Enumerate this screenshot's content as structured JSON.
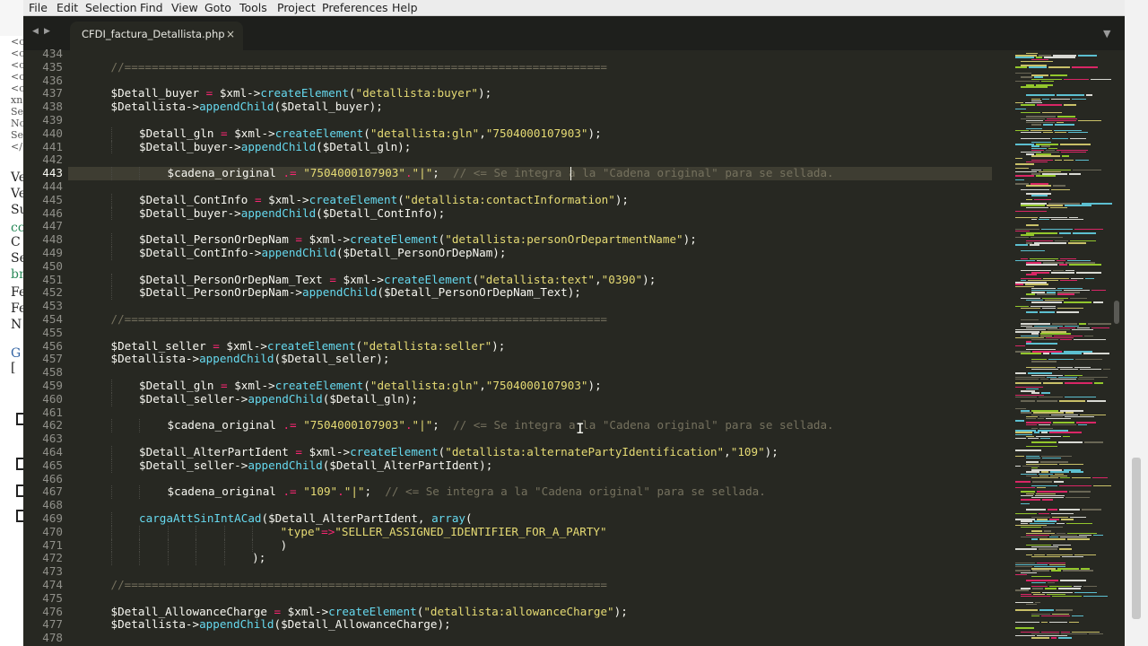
{
  "menu": [
    "File",
    "Edit",
    "Selection",
    "Find",
    "View",
    "Goto",
    "Tools",
    "Project",
    "Preferences",
    "Help"
  ],
  "tab": {
    "name": "CFDI_factura_Detallista.php",
    "close": "×"
  },
  "nav": {
    "back": "◀",
    "forward": "▶",
    "dropdown": "▼"
  },
  "background_page": {
    "left_fragments": [
      "<c",
      "<c",
      "<c",
      "<c",
      "<c",
      "xn",
      "Se",
      "No",
      "Se",
      "</",
      "Ve",
      "Ve",
      "Su",
      "cc",
      "C",
      "Se",
      "br",
      "Fe",
      "Fe",
      "N",
      "G",
      "["
    ]
  },
  "editor": {
    "current_line": 443,
    "lines": [
      {
        "n": 434,
        "indent": 0,
        "tokens": []
      },
      {
        "n": 435,
        "indent": 4,
        "tokens": [
          {
            "t": "//=======================================================================",
            "c": "cm"
          }
        ]
      },
      {
        "n": 436,
        "indent": 0,
        "tokens": []
      },
      {
        "n": 437,
        "indent": 4,
        "tokens": [
          {
            "t": "$Detall_buyer",
            "c": "v"
          },
          {
            "t": " = ",
            "c": "op"
          },
          {
            "t": "$xml->",
            "c": "v"
          },
          {
            "t": "createElement",
            "c": "fn"
          },
          {
            "t": "(",
            "c": "p"
          },
          {
            "t": "\"detallista:buyer\"",
            "c": "str"
          },
          {
            "t": ");",
            "c": "p"
          }
        ]
      },
      {
        "n": 438,
        "indent": 4,
        "tokens": [
          {
            "t": "$Detallista->",
            "c": "v"
          },
          {
            "t": "appendChild",
            "c": "fn"
          },
          {
            "t": "($Detall_buyer);",
            "c": "p"
          }
        ]
      },
      {
        "n": 439,
        "indent": 0,
        "tokens": []
      },
      {
        "n": 440,
        "indent": 8,
        "tokens": [
          {
            "t": "$Detall_gln",
            "c": "v"
          },
          {
            "t": " = ",
            "c": "op"
          },
          {
            "t": "$xml->",
            "c": "v"
          },
          {
            "t": "createElement",
            "c": "fn"
          },
          {
            "t": "(",
            "c": "p"
          },
          {
            "t": "\"detallista:gln\"",
            "c": "str"
          },
          {
            "t": ",",
            "c": "p"
          },
          {
            "t": "\"7504000107903\"",
            "c": "str"
          },
          {
            "t": ");",
            "c": "p"
          }
        ]
      },
      {
        "n": 441,
        "indent": 8,
        "tokens": [
          {
            "t": "$Detall_buyer->",
            "c": "v"
          },
          {
            "t": "appendChild",
            "c": "fn"
          },
          {
            "t": "($Detall_gln);",
            "c": "p"
          }
        ]
      },
      {
        "n": 442,
        "indent": 0,
        "tokens": []
      },
      {
        "n": 443,
        "indent": 12,
        "tokens": [
          {
            "t": "$cadena_original",
            "c": "v"
          },
          {
            "t": " .= ",
            "c": "op"
          },
          {
            "t": "\"7504000107903\"",
            "c": "str"
          },
          {
            "t": ".",
            "c": "op"
          },
          {
            "t": "\"|\"",
            "c": "str"
          },
          {
            "t": ";  ",
            "c": "p"
          },
          {
            "t": "// <= Se integra a la \"Cadena original\" para se sellada.",
            "c": "cm"
          }
        ]
      },
      {
        "n": 444,
        "indent": 0,
        "tokens": []
      },
      {
        "n": 445,
        "indent": 8,
        "tokens": [
          {
            "t": "$Detall_ContInfo",
            "c": "v"
          },
          {
            "t": " = ",
            "c": "op"
          },
          {
            "t": "$xml->",
            "c": "v"
          },
          {
            "t": "createElement",
            "c": "fn"
          },
          {
            "t": "(",
            "c": "p"
          },
          {
            "t": "\"detallista:contactInformation\"",
            "c": "str"
          },
          {
            "t": ");",
            "c": "p"
          }
        ]
      },
      {
        "n": 446,
        "indent": 8,
        "tokens": [
          {
            "t": "$Detall_buyer->",
            "c": "v"
          },
          {
            "t": "appendChild",
            "c": "fn"
          },
          {
            "t": "($Detall_ContInfo);",
            "c": "p"
          }
        ]
      },
      {
        "n": 447,
        "indent": 0,
        "tokens": []
      },
      {
        "n": 448,
        "indent": 8,
        "tokens": [
          {
            "t": "$Detall_PersonOrDepNam",
            "c": "v"
          },
          {
            "t": " = ",
            "c": "op"
          },
          {
            "t": "$xml->",
            "c": "v"
          },
          {
            "t": "createElement",
            "c": "fn"
          },
          {
            "t": "(",
            "c": "p"
          },
          {
            "t": "\"detallista:personOrDepartmentName\"",
            "c": "str"
          },
          {
            "t": ");",
            "c": "p"
          }
        ]
      },
      {
        "n": 449,
        "indent": 8,
        "tokens": [
          {
            "t": "$Detall_ContInfo->",
            "c": "v"
          },
          {
            "t": "appendChild",
            "c": "fn"
          },
          {
            "t": "($Detall_PersonOrDepNam);",
            "c": "p"
          }
        ]
      },
      {
        "n": 450,
        "indent": 0,
        "tokens": []
      },
      {
        "n": 451,
        "indent": 8,
        "tokens": [
          {
            "t": "$Detall_PersonOrDepNam_Text",
            "c": "v"
          },
          {
            "t": " = ",
            "c": "op"
          },
          {
            "t": "$xml->",
            "c": "v"
          },
          {
            "t": "createElement",
            "c": "fn"
          },
          {
            "t": "(",
            "c": "p"
          },
          {
            "t": "\"detallista:text\"",
            "c": "str"
          },
          {
            "t": ",",
            "c": "p"
          },
          {
            "t": "\"0390\"",
            "c": "str"
          },
          {
            "t": ");",
            "c": "p"
          }
        ]
      },
      {
        "n": 452,
        "indent": 8,
        "tokens": [
          {
            "t": "$Detall_PersonOrDepNam->",
            "c": "v"
          },
          {
            "t": "appendChild",
            "c": "fn"
          },
          {
            "t": "($Detall_PersonOrDepNam_Text);",
            "c": "p"
          }
        ]
      },
      {
        "n": 453,
        "indent": 0,
        "tokens": []
      },
      {
        "n": 454,
        "indent": 4,
        "tokens": [
          {
            "t": "//=======================================================================",
            "c": "cm"
          }
        ]
      },
      {
        "n": 455,
        "indent": 0,
        "tokens": []
      },
      {
        "n": 456,
        "indent": 4,
        "tokens": [
          {
            "t": "$Detall_seller",
            "c": "v"
          },
          {
            "t": " = ",
            "c": "op"
          },
          {
            "t": "$xml->",
            "c": "v"
          },
          {
            "t": "createElement",
            "c": "fn"
          },
          {
            "t": "(",
            "c": "p"
          },
          {
            "t": "\"detallista:seller\"",
            "c": "str"
          },
          {
            "t": ");",
            "c": "p"
          }
        ]
      },
      {
        "n": 457,
        "indent": 4,
        "tokens": [
          {
            "t": "$Detallista->",
            "c": "v"
          },
          {
            "t": "appendChild",
            "c": "fn"
          },
          {
            "t": "($Detall_seller);",
            "c": "p"
          }
        ]
      },
      {
        "n": 458,
        "indent": 0,
        "tokens": []
      },
      {
        "n": 459,
        "indent": 8,
        "tokens": [
          {
            "t": "$Detall_gln",
            "c": "v"
          },
          {
            "t": " = ",
            "c": "op"
          },
          {
            "t": "$xml->",
            "c": "v"
          },
          {
            "t": "createElement",
            "c": "fn"
          },
          {
            "t": "(",
            "c": "p"
          },
          {
            "t": "\"detallista:gln\"",
            "c": "str"
          },
          {
            "t": ",",
            "c": "p"
          },
          {
            "t": "\"7504000107903\"",
            "c": "str"
          },
          {
            "t": ");",
            "c": "p"
          }
        ]
      },
      {
        "n": 460,
        "indent": 8,
        "tokens": [
          {
            "t": "$Detall_seller->",
            "c": "v"
          },
          {
            "t": "appendChild",
            "c": "fn"
          },
          {
            "t": "($Detall_gln);",
            "c": "p"
          }
        ]
      },
      {
        "n": 461,
        "indent": 0,
        "tokens": []
      },
      {
        "n": 462,
        "indent": 12,
        "tokens": [
          {
            "t": "$cadena_original",
            "c": "v"
          },
          {
            "t": " .= ",
            "c": "op"
          },
          {
            "t": "\"7504000107903\"",
            "c": "str"
          },
          {
            "t": ".",
            "c": "op"
          },
          {
            "t": "\"|\"",
            "c": "str"
          },
          {
            "t": ";  ",
            "c": "p"
          },
          {
            "t": "// <= Se integra a la \"Cadena original\" para se sellada.",
            "c": "cm"
          }
        ]
      },
      {
        "n": 463,
        "indent": 0,
        "tokens": []
      },
      {
        "n": 464,
        "indent": 8,
        "tokens": [
          {
            "t": "$Detall_AlterPartIdent",
            "c": "v"
          },
          {
            "t": " = ",
            "c": "op"
          },
          {
            "t": "$xml->",
            "c": "v"
          },
          {
            "t": "createElement",
            "c": "fn"
          },
          {
            "t": "(",
            "c": "p"
          },
          {
            "t": "\"detallista:alternatePartyIdentification\"",
            "c": "str"
          },
          {
            "t": ",",
            "c": "p"
          },
          {
            "t": "\"109\"",
            "c": "str"
          },
          {
            "t": ");",
            "c": "p"
          }
        ]
      },
      {
        "n": 465,
        "indent": 8,
        "tokens": [
          {
            "t": "$Detall_seller->",
            "c": "v"
          },
          {
            "t": "appendChild",
            "c": "fn"
          },
          {
            "t": "($Detall_AlterPartIdent);",
            "c": "p"
          }
        ]
      },
      {
        "n": 466,
        "indent": 0,
        "tokens": []
      },
      {
        "n": 467,
        "indent": 12,
        "tokens": [
          {
            "t": "$cadena_original",
            "c": "v"
          },
          {
            "t": " .= ",
            "c": "op"
          },
          {
            "t": "\"109\"",
            "c": "str"
          },
          {
            "t": ".",
            "c": "op"
          },
          {
            "t": "\"|\"",
            "c": "str"
          },
          {
            "t": ";  ",
            "c": "p"
          },
          {
            "t": "// <= Se integra a la \"Cadena original\" para se sellada.",
            "c": "cm"
          }
        ]
      },
      {
        "n": 468,
        "indent": 0,
        "tokens": []
      },
      {
        "n": 469,
        "indent": 8,
        "tokens": [
          {
            "t": "cargaAttSinIntACad",
            "c": "fn"
          },
          {
            "t": "($Detall_AlterPartIdent, ",
            "c": "p"
          },
          {
            "t": "array",
            "c": "fn"
          },
          {
            "t": "(",
            "c": "p"
          }
        ]
      },
      {
        "n": 470,
        "indent": 28,
        "tokens": [
          {
            "t": "\"type\"",
            "c": "str"
          },
          {
            "t": "=>",
            "c": "op"
          },
          {
            "t": "\"SELLER_ASSIGNED_IDENTIFIER_FOR_A_PARTY\"",
            "c": "str"
          }
        ]
      },
      {
        "n": 471,
        "indent": 28,
        "tokens": [
          {
            "t": ")",
            "c": "p"
          }
        ]
      },
      {
        "n": 472,
        "indent": 24,
        "tokens": [
          {
            "t": ");",
            "c": "p"
          }
        ]
      },
      {
        "n": 473,
        "indent": 0,
        "tokens": []
      },
      {
        "n": 474,
        "indent": 4,
        "tokens": [
          {
            "t": "//=======================================================================",
            "c": "cm"
          }
        ]
      },
      {
        "n": 475,
        "indent": 0,
        "tokens": []
      },
      {
        "n": 476,
        "indent": 4,
        "tokens": [
          {
            "t": "$Detall_AllowanceCharge",
            "c": "v"
          },
          {
            "t": " = ",
            "c": "op"
          },
          {
            "t": "$xml->",
            "c": "v"
          },
          {
            "t": "createElement",
            "c": "fn"
          },
          {
            "t": "(",
            "c": "p"
          },
          {
            "t": "\"detallista:allowanceCharge\"",
            "c": "str"
          },
          {
            "t": ");",
            "c": "p"
          }
        ]
      },
      {
        "n": 477,
        "indent": 4,
        "tokens": [
          {
            "t": "$Detallista->",
            "c": "v"
          },
          {
            "t": "appendChild",
            "c": "fn"
          },
          {
            "t": "($Detall_AllowanceCharge);",
            "c": "p"
          }
        ]
      },
      {
        "n": 478,
        "indent": 0,
        "tokens": []
      }
    ]
  },
  "colors": {
    "editor_bg": "#272822",
    "keyword": "#f92672",
    "function": "#66d9ef",
    "string": "#e6db74",
    "comment": "#75715e",
    "text": "#f8f8f2"
  }
}
